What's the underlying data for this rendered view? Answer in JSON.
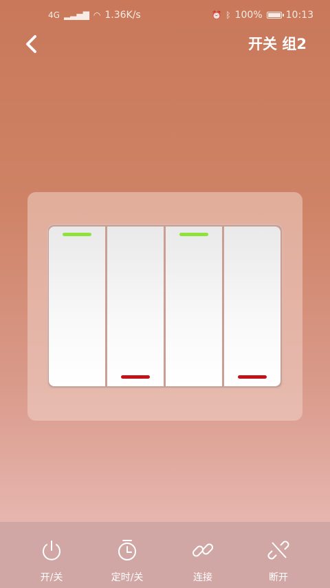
{
  "status_bar": {
    "network": "4G",
    "speed": "1.36K/s",
    "battery": "100%",
    "time": "10:13"
  },
  "header": {
    "title": "开关 组2"
  },
  "switch_panel": {
    "keys": [
      {
        "name": "key-1",
        "indicator": "top",
        "indicator_color": "#8fe23a"
      },
      {
        "name": "key-2",
        "indicator": "bottom",
        "indicator_color": "#c0141a"
      },
      {
        "name": "key-3",
        "indicator": "top",
        "indicator_color": "#8fe23a"
      },
      {
        "name": "key-4",
        "indicator": "bottom",
        "indicator_color": "#c0141a"
      }
    ]
  },
  "actions": [
    {
      "label": "开/关",
      "icon": "power-icon"
    },
    {
      "label": "定时/关",
      "icon": "timer-icon"
    },
    {
      "label": "连接",
      "icon": "link-icon"
    },
    {
      "label": "断开",
      "icon": "unlink-icon"
    }
  ]
}
